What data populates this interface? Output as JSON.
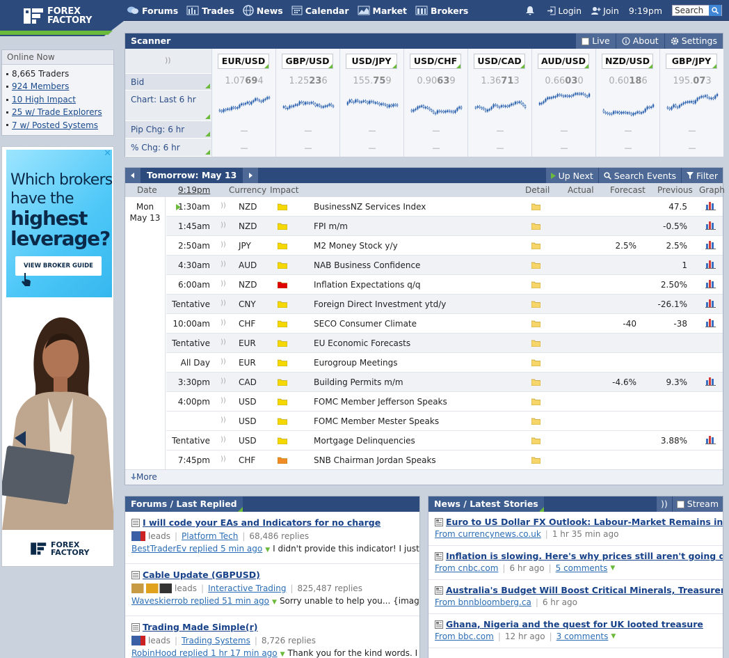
{
  "header": {
    "logo_line1": "FOREX",
    "logo_line2": "FACTORY",
    "nav": [
      "Forums",
      "Trades",
      "News",
      "Calendar",
      "Market",
      "Brokers"
    ],
    "login": "Login",
    "join": "Join",
    "time": "9:19pm",
    "search_placeholder": "Search"
  },
  "online": {
    "title": "Online Now",
    "traders": "8,665 Traders",
    "links": [
      "924 Members",
      "10 High Impact",
      "25 w/ Trade Explorers",
      "7 w/ Posted Systems"
    ]
  },
  "ad": {
    "line1": "Which brokers",
    "line2": "have the",
    "line3": "highest",
    "line4": "leverage?",
    "button": "VIEW BROKER GUIDE",
    "close": "✕",
    "logo_line1": "FOREX",
    "logo_line2": "FACTORY"
  },
  "scanner": {
    "title": "Scanner",
    "tabs": [
      "Live",
      "About",
      "Settings"
    ],
    "rows": [
      "Bid",
      "Chart: Last 6 hr",
      "Pip Chg: 6 hr",
      "% Chg: 6 hr"
    ],
    "pairs": [
      {
        "name": "EUR/USD",
        "bid_pre": "1.07",
        "bid_big": "69",
        "bid_post": "4",
        "pip": "—",
        "pct": "—"
      },
      {
        "name": "GBP/USD",
        "bid_pre": "1.25",
        "bid_big": "23",
        "bid_post": "6",
        "pip": "—",
        "pct": "—"
      },
      {
        "name": "USD/JPY",
        "bid_pre": "155.",
        "bid_big": "75",
        "bid_post": "9",
        "pip": "—",
        "pct": "—"
      },
      {
        "name": "USD/CHF",
        "bid_pre": "0.90",
        "bid_big": "63",
        "bid_post": "9",
        "pip": "—",
        "pct": "—"
      },
      {
        "name": "USD/CAD",
        "bid_pre": "1.36",
        "bid_big": "71",
        "bid_post": "3",
        "pip": "—",
        "pct": "—"
      },
      {
        "name": "AUD/USD",
        "bid_pre": "0.66",
        "bid_big": "03",
        "bid_post": "0",
        "pip": "—",
        "pct": "—"
      },
      {
        "name": "NZD/USD",
        "bid_pre": "0.60",
        "bid_big": "18",
        "bid_post": "6",
        "pip": "—",
        "pct": "—"
      },
      {
        "name": "GBP/JPY",
        "bid_pre": "195.",
        "bid_big": "07",
        "bid_post": "3",
        "pip": "—",
        "pct": "—"
      }
    ]
  },
  "calendar": {
    "title": "Tomorrow: May 13",
    "tools": [
      "Up Next",
      "Search Events",
      "Filter"
    ],
    "columns": [
      "Date",
      "9:19pm",
      "Currency",
      "Impact",
      "Detail",
      "Actual",
      "Forecast",
      "Previous",
      "Graph"
    ],
    "day": "Mon",
    "date": "May 13",
    "more": "More",
    "colors": {
      "high": "#e00000",
      "medium": "#f08a24",
      "low": "#f5d800"
    },
    "events": [
      {
        "time": "1:30am",
        "cur": "NZD",
        "impact": "low",
        "title": "BusinessNZ Services Index",
        "forecast": "",
        "previous": "47.5",
        "graph": true
      },
      {
        "time": "1:45am",
        "cur": "NZD",
        "impact": "low",
        "title": "FPI m/m",
        "forecast": "",
        "previous": "-0.5%",
        "graph": true
      },
      {
        "time": "2:50am",
        "cur": "JPY",
        "impact": "low",
        "title": "M2 Money Stock y/y",
        "forecast": "2.5%",
        "previous": "2.5%",
        "graph": true
      },
      {
        "time": "4:30am",
        "cur": "AUD",
        "impact": "low",
        "title": "NAB Business Confidence",
        "forecast": "",
        "previous": "1",
        "graph": true
      },
      {
        "time": "6:00am",
        "cur": "NZD",
        "impact": "high",
        "title": "Inflation Expectations q/q",
        "forecast": "",
        "previous": "2.50%",
        "graph": true
      },
      {
        "time": "Tentative",
        "cur": "CNY",
        "impact": "low",
        "title": "Foreign Direct Investment ytd/y",
        "forecast": "",
        "previous": "-26.1%",
        "graph": true
      },
      {
        "time": "10:00am",
        "cur": "CHF",
        "impact": "low",
        "title": "SECO Consumer Climate",
        "forecast": "-40",
        "previous": "-38",
        "graph": true
      },
      {
        "time": "Tentative",
        "cur": "EUR",
        "impact": "low",
        "title": "EU Economic Forecasts",
        "forecast": "",
        "previous": "",
        "graph": false
      },
      {
        "time": "All Day",
        "cur": "EUR",
        "impact": "low",
        "title": "Eurogroup Meetings",
        "forecast": "",
        "previous": "",
        "graph": false
      },
      {
        "time": "3:30pm",
        "cur": "CAD",
        "impact": "low",
        "title": "Building Permits m/m",
        "forecast": "-4.6%",
        "previous": "9.3%",
        "graph": true
      },
      {
        "time": "4:00pm",
        "cur": "USD",
        "impact": "low",
        "title": "FOMC Member Jefferson Speaks",
        "forecast": "",
        "previous": "",
        "graph": false
      },
      {
        "time": "",
        "cur": "USD",
        "impact": "low",
        "title": "FOMC Member Mester Speaks",
        "forecast": "",
        "previous": "",
        "graph": false
      },
      {
        "time": "Tentative",
        "cur": "USD",
        "impact": "low",
        "title": "Mortgage Delinquencies",
        "forecast": "",
        "previous": "3.88%",
        "graph": true
      },
      {
        "time": "7:45pm",
        "cur": "CHF",
        "impact": "medium",
        "title": "SNB Chairman Jordan Speaks",
        "forecast": "",
        "previous": "",
        "graph": false
      }
    ]
  },
  "forums": {
    "title": "Forums / Last Replied",
    "threads": [
      {
        "title": "I will code your EAs and Indicators for no charge",
        "leads": "leads",
        "forum": "Platform Tech",
        "replies": "68,486 replies",
        "user": "BestTraderEv replied 5 min ago",
        "snippet": "I didn't provide this indicator! I just a"
      },
      {
        "title": "Cable Update (GBPUSD)",
        "leads": "leads",
        "forum": "Interactive Trading",
        "replies": "825,487 replies",
        "user": "Waveskierrob replied 51 min ago",
        "snippet": "Sorry unable to help you... {image"
      },
      {
        "title": "Trading Made Simple(r)",
        "leads": "leads",
        "forum": "Trading Systems",
        "replies": "8,726 replies",
        "user": "RobinHood replied 1 hr 17 min ago",
        "snippet": "Thank you for the kind words. I a"
      }
    ]
  },
  "news": {
    "title": "News / Latest Stories",
    "stream": "Stream",
    "stories": [
      {
        "title": "Euro to US Dollar FX Outlook: Labour-Market Remains in Foc",
        "source": "From currencynews.co.uk",
        "time": "1 hr 35 min ago",
        "comments": ""
      },
      {
        "title": "Inflation is slowing. Here's why prices still aren't going dow",
        "source": "From cnbc.com",
        "time": "6 hr ago",
        "comments": "5 comments"
      },
      {
        "title": "Australia's Budget Will Boost Critical Minerals, Treasurer Sa",
        "source": "From bnnbloomberg.ca",
        "time": "6 hr ago",
        "comments": ""
      },
      {
        "title": "Ghana, Nigeria and the quest for UK looted treasure",
        "source": "From bbc.com",
        "time": "12 hr ago",
        "comments": "3 comments"
      }
    ]
  }
}
